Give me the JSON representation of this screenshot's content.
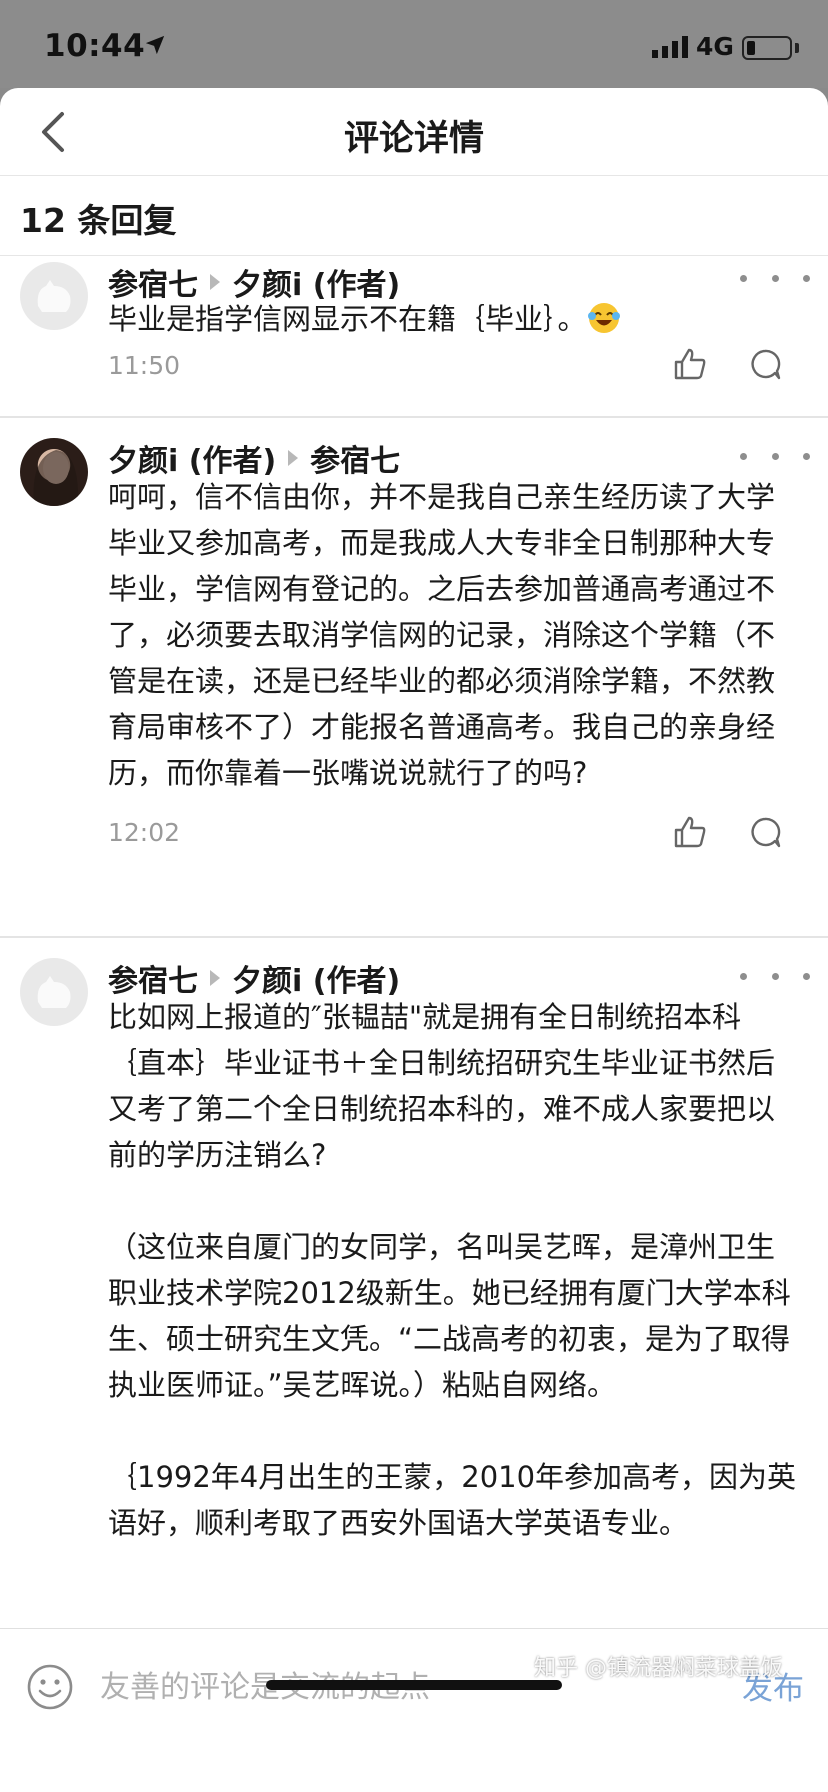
{
  "status_bar": {
    "time": "10:44",
    "network": "4G"
  },
  "nav": {
    "title": "评论详情"
  },
  "replies": {
    "count_text": "12 条回复"
  },
  "comments": [
    {
      "author": "参宿七",
      "reply_to": "夕颜i (作者)",
      "text": "毕业是指学信网显示不在籍｛毕业｝。",
      "time": "11:50"
    },
    {
      "author": "夕颜i (作者)",
      "reply_to": "参宿七",
      "text": "呵呵，信不信由你，并不是我自己亲生经历读了大学毕业又参加高考，而是我成人大专非全日制那种大专毕业，学信网有登记的。之后去参加普通高考通过不了，必须要去取消学信网的记录，消除这个学籍（不管是在读，还是已经毕业的都必须消除学籍，不然教育局审核不了）才能报名普通高考。我自己的亲身经历，而你靠着一张嘴说说就行了的吗?",
      "time": "12:02"
    },
    {
      "author": "参宿七",
      "reply_to": "夕颜i (作者)",
      "text": "比如网上报道的″张韫喆\"就是拥有全日制统招本科｛直本｝毕业证书＋全日制统招研究生毕业证书然后又考了第二个全日制统招本科的，难不成人家要把以前的学历注销么?\n\n（这位来自厦门的女同学，名叫吴艺晖，是漳州卫生职业技术学院2012级新生。她已经拥有厦门大学本科生、硕士研究生文凭。“二战高考的初衷，是为了取得执业医师证。”吴艺晖说。）粘贴自网络。\n\n｛1992年4月出生的王蒙，2010年参加高考，因为英语好，顺利考取了西安外国语大学英语专业。"
    }
  ],
  "input_bar": {
    "placeholder": "友善的评论是交流的起点",
    "publish_label": "发布"
  },
  "watermark": "知乎 @镇流器焖菜球盖饭",
  "colors": {
    "accent_blue": "#7aa3d6",
    "status_bar_gray": "#8c8c8c",
    "meta_gray": "#9a9a9a"
  }
}
